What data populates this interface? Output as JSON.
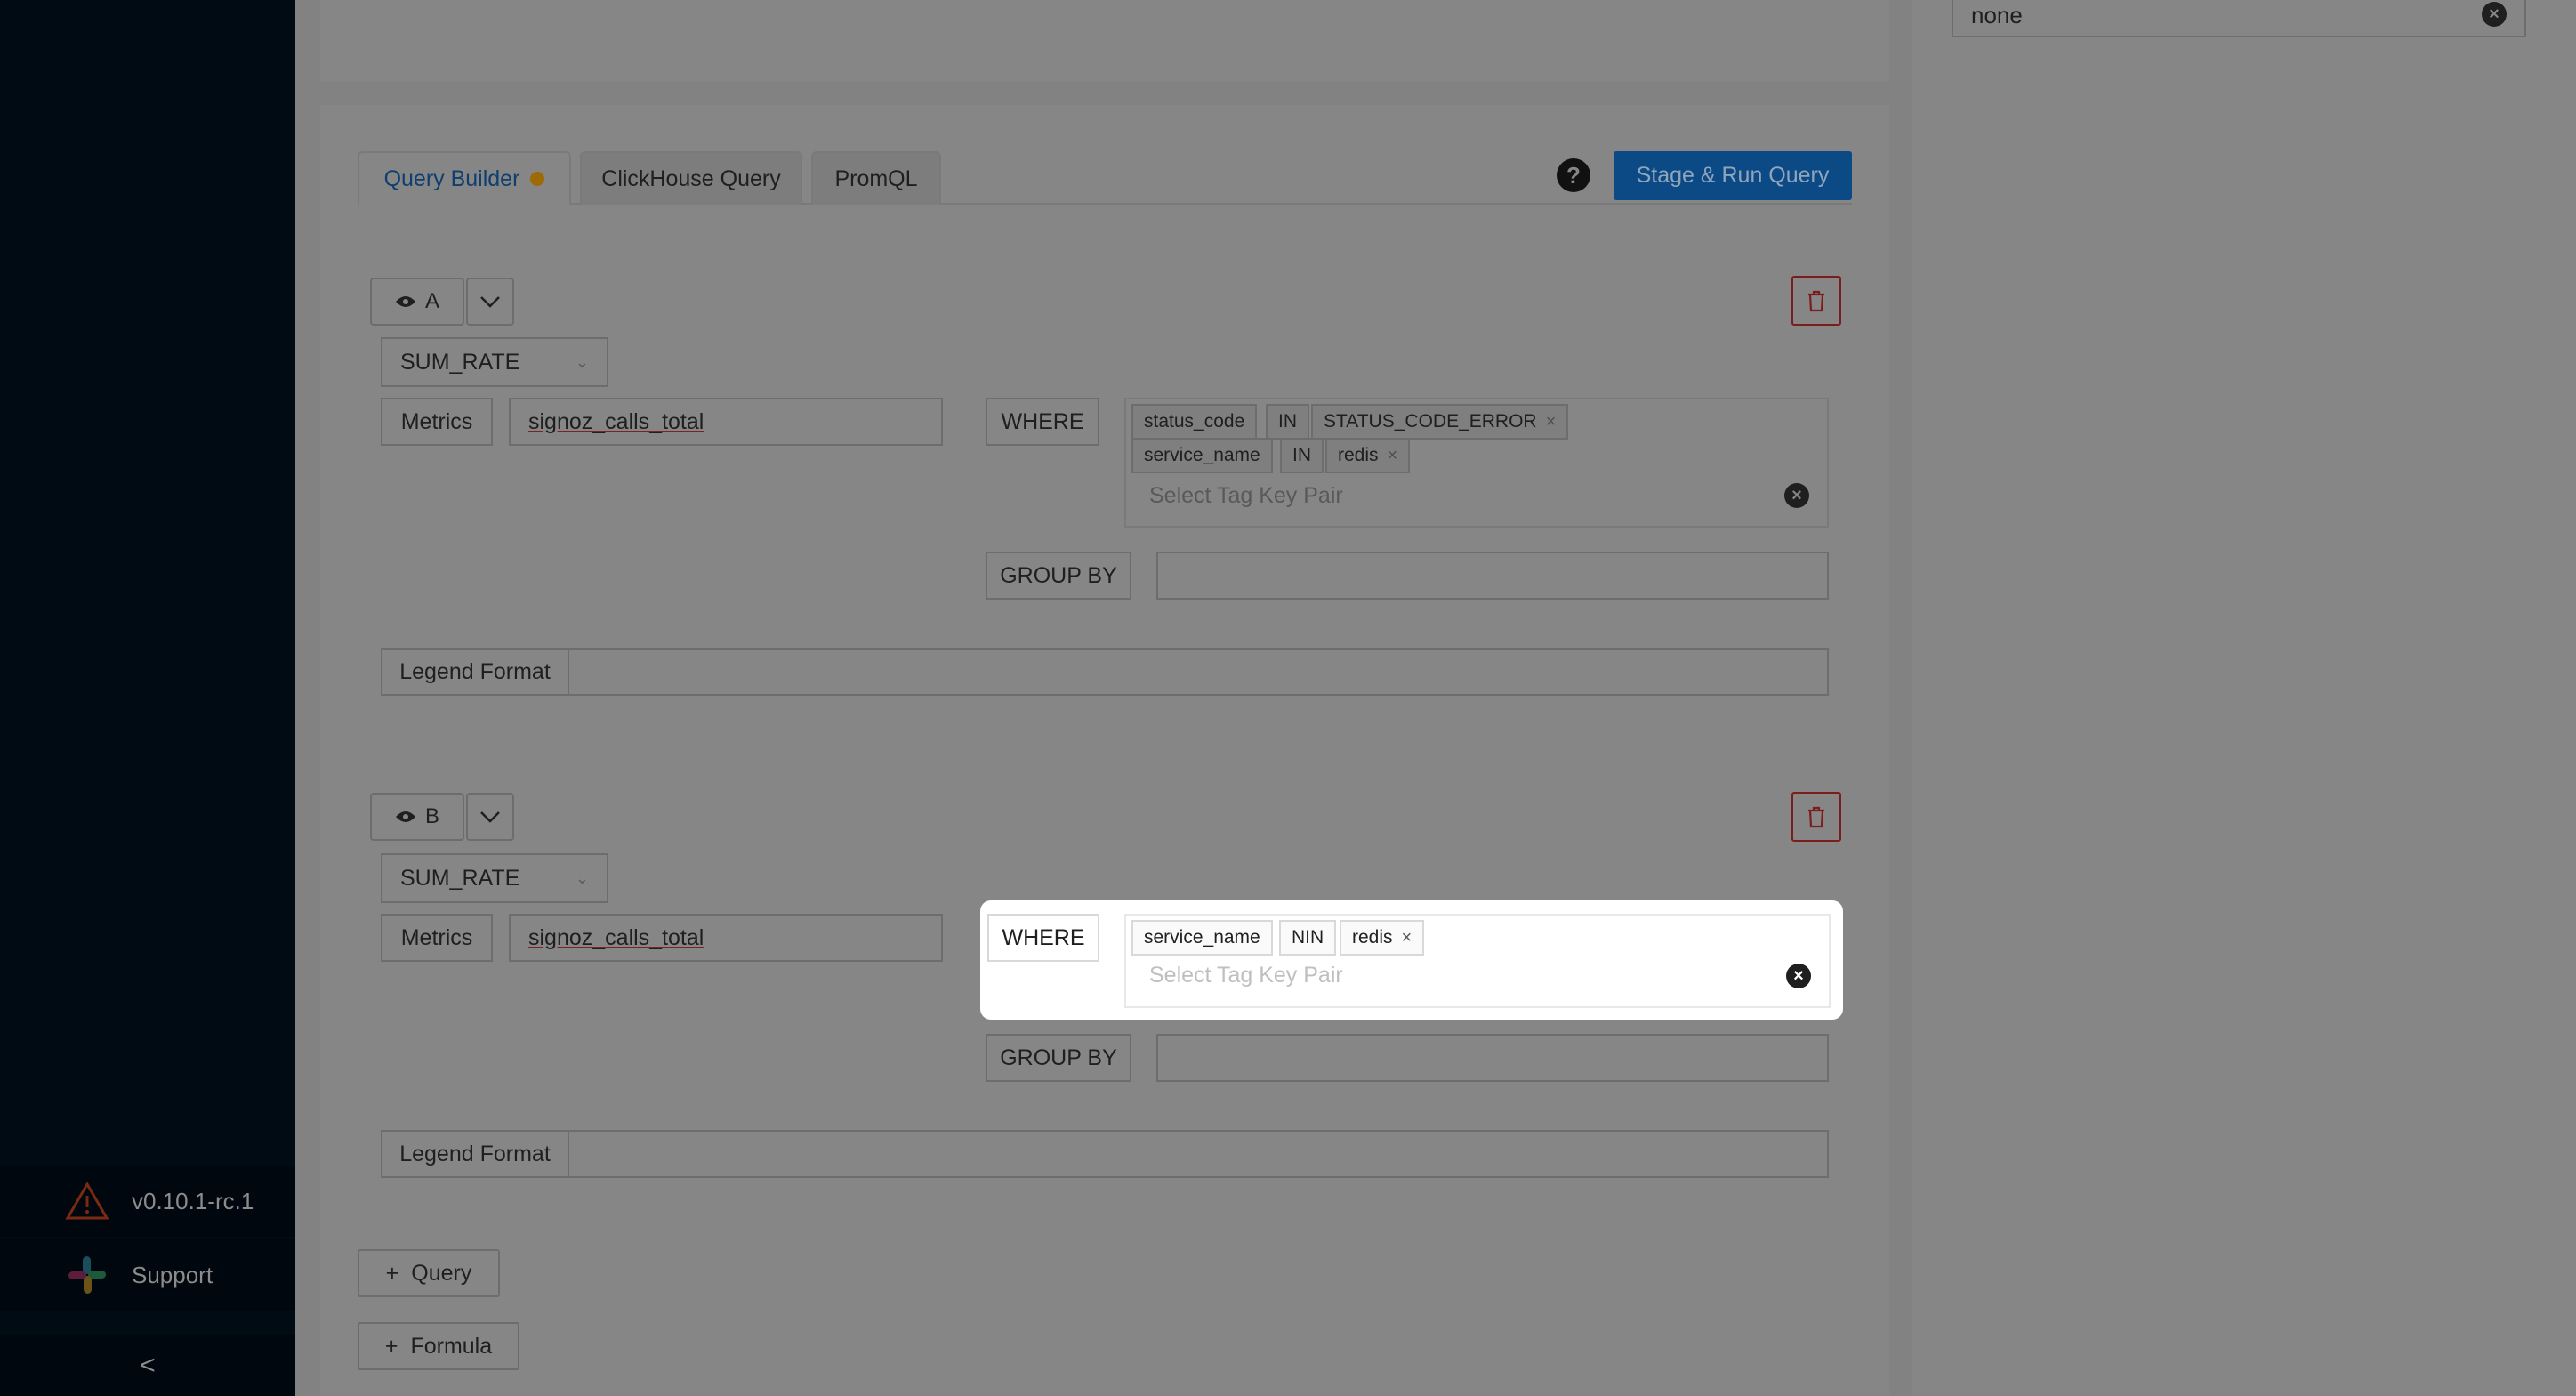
{
  "sidebar": {
    "version": "v0.10.1-rc.1",
    "support_label": "Support",
    "collapse_glyph": "<",
    "warning_icon": "warning-triangle-icon",
    "slack_icon": "slack-icon"
  },
  "right_panel": {
    "select_value": "none"
  },
  "tabs": {
    "query_builder": "Query Builder",
    "clickhouse": "ClickHouse Query",
    "promql": "PromQL"
  },
  "help_glyph": "?",
  "run_button": "Stage & Run Query",
  "queries": [
    {
      "name": "A",
      "aggregation": "SUM_RATE",
      "metrics_label": "Metrics",
      "metric_value": "signoz_calls_total",
      "where_label": "WHERE",
      "filters": [
        {
          "key": "status_code",
          "op": "IN",
          "value": "STATUS_CODE_ERROR"
        },
        {
          "key": "service_name",
          "op": "IN",
          "value": "redis"
        }
      ],
      "tag_placeholder": "Select Tag Key Pair",
      "group_by_label": "GROUP BY",
      "legend_label": "Legend Format"
    },
    {
      "name": "B",
      "aggregation": "SUM_RATE",
      "metrics_label": "Metrics",
      "metric_value": "signoz_calls_total",
      "where_label": "WHERE",
      "filters": [
        {
          "key": "service_name",
          "op": "NIN",
          "value": "redis"
        }
      ],
      "tag_placeholder": "Select Tag Key Pair",
      "group_by_label": "GROUP BY",
      "legend_label": "Legend Format"
    }
  ],
  "add_query_label": "Query",
  "add_formula_label": "Formula",
  "plus_glyph": "+",
  "close_glyph": "×",
  "colors": {
    "accent": "#1677ff",
    "danger": "#e5484d",
    "sidebar": "#001529",
    "overlay": "rgba(0,0,0,0.45)"
  }
}
